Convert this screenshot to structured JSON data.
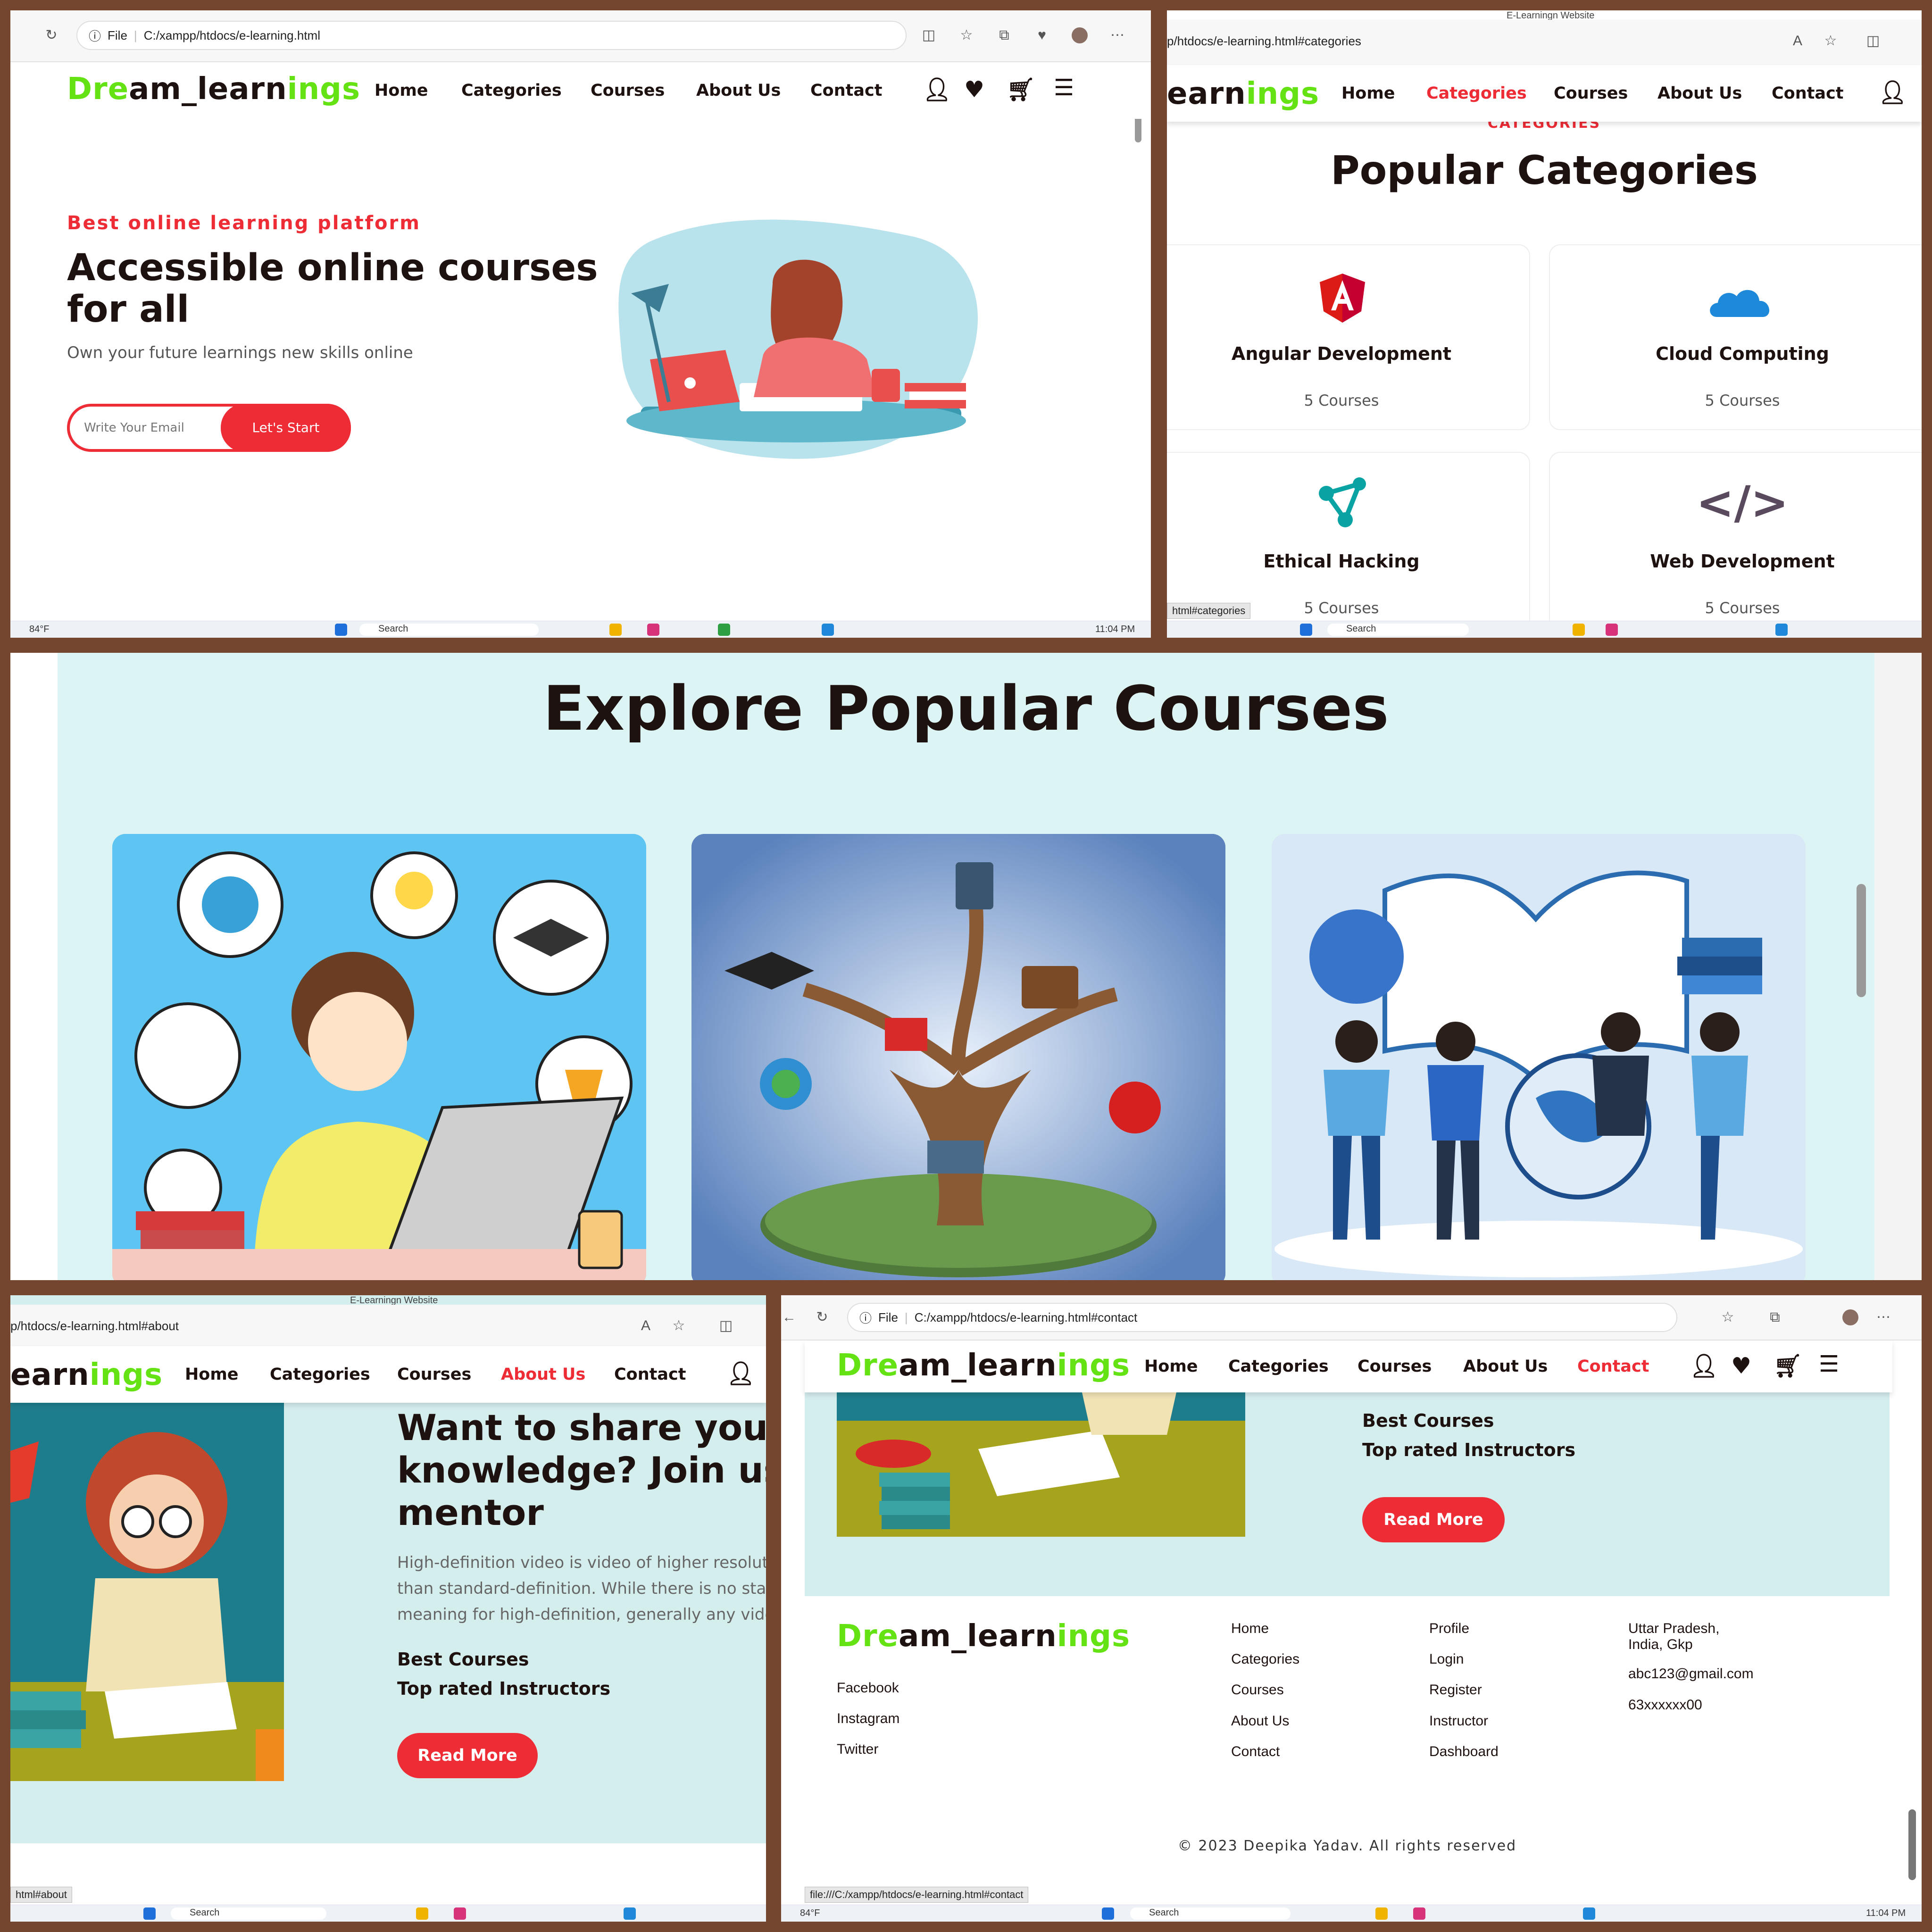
{
  "panel1": {
    "address": {
      "file_label": "File",
      "url": "C:/xampp/htdocs/e-learning.html"
    },
    "logo": {
      "p1": "Dre",
      "p2": "am_learn",
      "p3": "ings"
    },
    "nav": [
      "Home",
      "Categories",
      "Courses",
      "About Us",
      "Contact"
    ],
    "hero": {
      "tagline": "Best online learning platform",
      "title_line1": "Accessible online courses",
      "title_line2": "for all",
      "subtitle": "Own your future learnings new skills online",
      "email_placeholder": "Write Your Email",
      "cta": "Let's Start"
    },
    "taskbar": {
      "weather": "84°F",
      "search": "Search",
      "time": "11:04 PM"
    }
  },
  "panel2": {
    "tab_title": "E-Learningn Website",
    "address": {
      "url": "p/htdocs/e-learning.html#categories"
    },
    "logo": {
      "p2": "earn",
      "p3": "ings"
    },
    "nav": [
      "Home",
      "Categories",
      "Courses",
      "About Us",
      "Contact"
    ],
    "active": "Categories",
    "section_label": "CATEGORIES",
    "section_title": "Popular Categories",
    "categories": [
      {
        "name": "Angular Development",
        "count": "5 Courses",
        "icon": "angular-icon"
      },
      {
        "name": "Cloud Computing",
        "count": "5 Courses",
        "icon": "cloud-icon"
      },
      {
        "name": "Ethical Hacking",
        "count": "5 Courses",
        "icon": "network-icon"
      },
      {
        "name": "Web Development",
        "count": "5 Courses",
        "icon": "code-icon"
      }
    ],
    "status_url": "html#categories",
    "taskbar": {
      "search": "Search"
    }
  },
  "panel3": {
    "title": "Explore Popular Courses",
    "courses": [
      {
        "image": "girl-studying-laptop-illustration"
      },
      {
        "image": "education-tree-illustration"
      },
      {
        "image": "students-with-book-globe-illustration"
      }
    ]
  },
  "panel4": {
    "tab_title": "E-Learningn Website",
    "address": {
      "url": "p/htdocs/e-learning.html#about"
    },
    "logo": {
      "p2": "earn",
      "p3": "ings"
    },
    "nav": [
      "Home",
      "Categories",
      "Courses",
      "About Us",
      "Contact"
    ],
    "active": "About Us",
    "heading_line1": "Want to share your",
    "heading_line2": "knowledge? Join us",
    "heading_line3": "mentor",
    "paragraph_line1": "High-definition video is video of higher resolution",
    "paragraph_line2": "than standard-definition. While there is no standard",
    "paragraph_line3": "meaning for high-definition, generally any video.",
    "feature1": "Best Courses",
    "feature2": "Top rated Instructors",
    "cta": "Read More",
    "status_url": "html#about",
    "taskbar": {
      "search": "Search"
    }
  },
  "panel5": {
    "address": {
      "file_label": "File",
      "url": "C:/xampp/htdocs/e-learning.html#contact"
    },
    "logo": {
      "p1": "Dre",
      "p2": "am_learn",
      "p3": "ings"
    },
    "nav": [
      "Home",
      "Categories",
      "Courses",
      "About Us",
      "Contact"
    ],
    "active": "Contact",
    "feature1": "Best Courses",
    "feature2": "Top rated Instructors",
    "cta": "Read More",
    "footer": {
      "social": [
        "Facebook",
        "Instagram",
        "Twitter"
      ],
      "links1": [
        "Home",
        "Categories",
        "Courses",
        "About Us",
        "Contact"
      ],
      "links2": [
        "Profile",
        "Login",
        "Register",
        "Instructor",
        "Dashboard"
      ],
      "address_line1": "Uttar Pradesh,",
      "address_line2": "India, Gkp",
      "email": "abc123@gmail.com",
      "phone": "63xxxxxx00",
      "copyright": "© 2023 Deepika Yadav. All rights reserved"
    },
    "status_url": "file:///C:/xampp/htdocs/e-learning.html#contact",
    "taskbar": {
      "weather": "84°F",
      "search": "Search",
      "time": "11:04 PM"
    }
  },
  "colors": {
    "accent": "#ee2c36",
    "logo_green": "#65e214",
    "text_dark": "#1e1210",
    "section_bg": "#ddf4f4",
    "frame": "#74462f"
  }
}
